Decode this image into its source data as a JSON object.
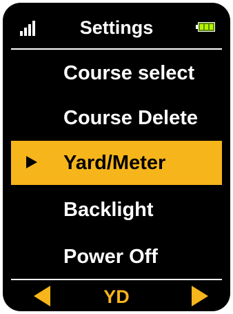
{
  "header": {
    "title": "Settings",
    "signal_icon": "signal-bars-icon",
    "battery_icon": "battery-full-icon",
    "battery_level": 1.0
  },
  "menu": {
    "items": [
      {
        "label": "Course select",
        "selected": false
      },
      {
        "label": "Course Delete",
        "selected": false
      },
      {
        "label": "Yard/Meter",
        "selected": true
      },
      {
        "label": "Backlight",
        "selected": false
      },
      {
        "label": "Power Off",
        "selected": false
      }
    ],
    "cursor_icon": "triangle-right-icon"
  },
  "footer": {
    "left_icon": "arrow-left-icon",
    "value": "YD",
    "right_icon": "arrow-right-icon"
  },
  "colors": {
    "background": "#000000",
    "text": "#ffffff",
    "accent": "#f7b51c",
    "battery": "#b8f400"
  }
}
